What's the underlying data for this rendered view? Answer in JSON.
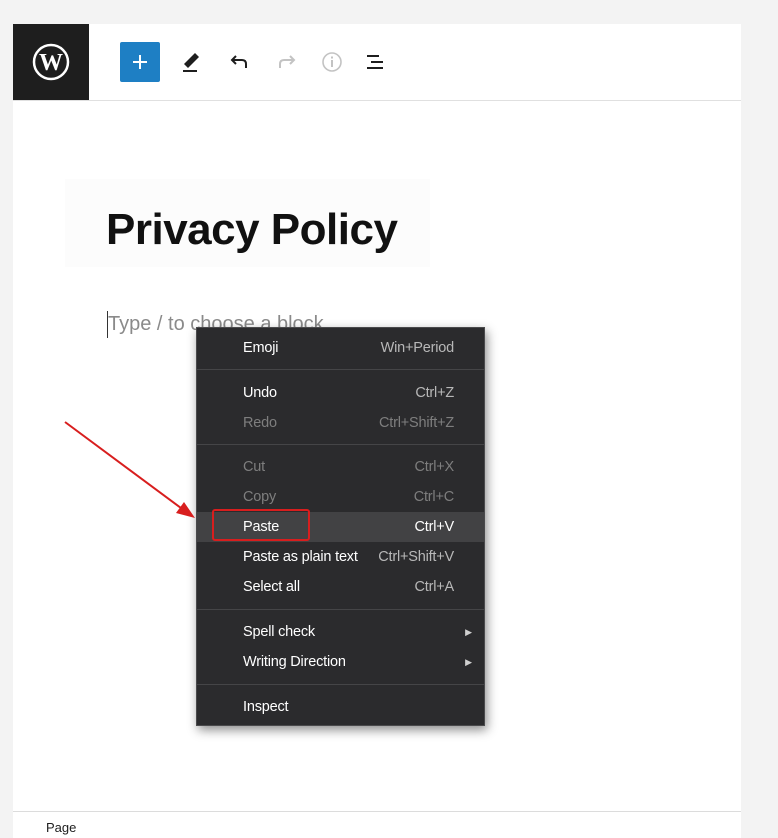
{
  "toolbar": {
    "logo_icon": "wordpress-logo",
    "buttons": [
      {
        "icon": "plus-icon"
      },
      {
        "icon": "pen-icon"
      },
      {
        "icon": "undo-icon"
      },
      {
        "icon": "redo-icon"
      },
      {
        "icon": "info-icon"
      },
      {
        "icon": "list-view-icon"
      }
    ],
    "accent_color": "#1e7fc4"
  },
  "editor": {
    "title": "Privacy Policy",
    "placeholder": "Type / to choose a block"
  },
  "context_menu": {
    "items": [
      {
        "label": "Emoji",
        "shortcut": "Win+Period",
        "enabled": true
      },
      {
        "label": "Undo",
        "shortcut": "Ctrl+Z",
        "enabled": true
      },
      {
        "label": "Redo",
        "shortcut": "Ctrl+Shift+Z",
        "enabled": false
      },
      {
        "label": "Cut",
        "shortcut": "Ctrl+X",
        "enabled": false
      },
      {
        "label": "Copy",
        "shortcut": "Ctrl+C",
        "enabled": false
      },
      {
        "label": "Paste",
        "shortcut": "Ctrl+V",
        "enabled": true,
        "highlighted": true
      },
      {
        "label": "Paste as plain text",
        "shortcut": "Ctrl+Shift+V",
        "enabled": true
      },
      {
        "label": "Select all",
        "shortcut": "Ctrl+A",
        "enabled": true
      },
      {
        "label": "Spell check",
        "shortcut": "",
        "enabled": true,
        "submenu": true
      },
      {
        "label": "Writing Direction",
        "shortcut": "",
        "enabled": true,
        "submenu": true
      },
      {
        "label": "Inspect",
        "shortcut": "",
        "enabled": true
      }
    ],
    "annotation_color": "#d81e1e"
  },
  "status": {
    "label": "Page"
  }
}
